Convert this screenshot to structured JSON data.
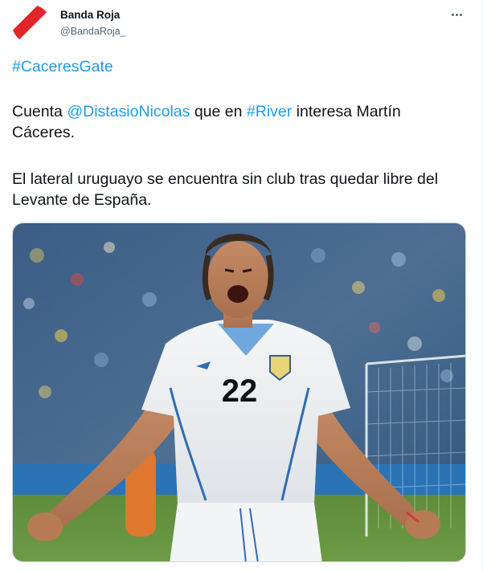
{
  "tweet": {
    "display_name": "Banda Roja",
    "handle": "@BandaRoja_",
    "hashtag_line": "#CaceresGate",
    "line1": {
      "prefix": "Cuenta ",
      "mention": "@DistasioNicolas",
      "middle": " que en ",
      "hashtag": "#River",
      "suffix": " interesa Martín Cáceres."
    },
    "line2": "El lateral uruguayo se encuentra sin club tras quedar libre del Levante de España.",
    "jersey_number": "22"
  },
  "icons": {
    "avatar": "red-diagonal-band-logo",
    "more": "more-horizontal-icon"
  },
  "colors": {
    "link": "#1d9bf0",
    "text": "#0f1419",
    "secondary": "#536471",
    "brand_red": "#e0262b"
  }
}
